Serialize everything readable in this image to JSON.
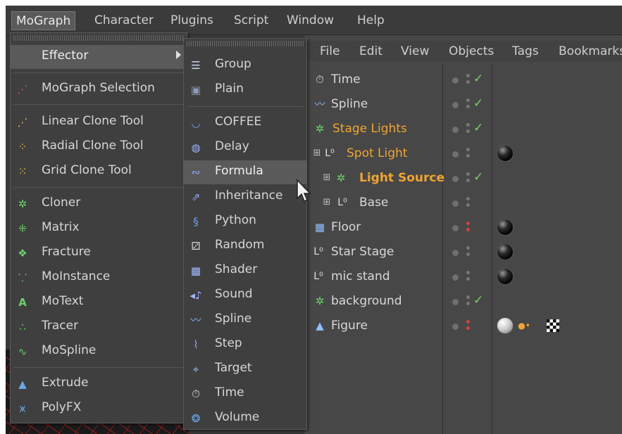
{
  "menubar": {
    "items": [
      "MoGraph",
      "Character",
      "Plugins",
      "Script",
      "Window",
      "Help"
    ]
  },
  "mograph_menu": {
    "items": [
      {
        "label": "Effector",
        "icon": "effector-submenu",
        "color": "#c8c8c8"
      },
      {
        "label": "MoGraph Selection",
        "icon": "mograph-selection-icon",
        "color": "#d25b5b"
      },
      {
        "label": "Linear Clone Tool",
        "icon": "linear-clone-icon",
        "color": "#e8c24a"
      },
      {
        "label": "Radial Clone Tool",
        "icon": "radial-clone-icon",
        "color": "#e8c24a"
      },
      {
        "label": "Grid Clone Tool",
        "icon": "grid-clone-icon",
        "color": "#e8c24a"
      },
      {
        "label": "Cloner",
        "icon": "cloner-icon",
        "color": "#6ccf6c"
      },
      {
        "label": "Matrix",
        "icon": "matrix-icon",
        "color": "#6ccf6c"
      },
      {
        "label": "Fracture",
        "icon": "fracture-icon",
        "color": "#6ccf6c"
      },
      {
        "label": "MoInstance",
        "icon": "moinstance-icon",
        "color": "#6ccf6c"
      },
      {
        "label": "MoText",
        "icon": "motext-icon",
        "color": "#6ccf6c"
      },
      {
        "label": "Tracer",
        "icon": "tracer-icon",
        "color": "#6ccf6c"
      },
      {
        "label": "MoSpline",
        "icon": "mospline-icon",
        "color": "#6ccf6c"
      },
      {
        "label": "Extrude",
        "icon": "extrude-icon",
        "color": "#6aa7e8"
      },
      {
        "label": "PolyFX",
        "icon": "polyfx-icon",
        "color": "#6aa7e8"
      }
    ]
  },
  "effector_menu": {
    "items": [
      {
        "label": "Group",
        "icon": "group-icon"
      },
      {
        "label": "Plain",
        "icon": "plain-icon"
      },
      {
        "label": "COFFEE",
        "icon": "coffee-icon"
      },
      {
        "label": "Delay",
        "icon": "delay-icon"
      },
      {
        "label": "Formula",
        "icon": "formula-icon"
      },
      {
        "label": "Inheritance",
        "icon": "inheritance-icon"
      },
      {
        "label": "Python",
        "icon": "python-icon"
      },
      {
        "label": "Random",
        "icon": "random-icon"
      },
      {
        "label": "Shader",
        "icon": "shader-icon"
      },
      {
        "label": "Sound",
        "icon": "sound-icon"
      },
      {
        "label": "Spline",
        "icon": "spline-icon"
      },
      {
        "label": "Step",
        "icon": "step-icon"
      },
      {
        "label": "Target",
        "icon": "target-icon"
      },
      {
        "label": "Time",
        "icon": "time-icon"
      },
      {
        "label": "Volume",
        "icon": "volume-icon"
      }
    ],
    "highlighted": "Formula"
  },
  "object_manager": {
    "menu": [
      "File",
      "Edit",
      "View",
      "Objects",
      "Tags",
      "Bookmarks"
    ],
    "objects": [
      {
        "name": "Time",
        "icon": "time-icon",
        "highlight": false,
        "checked": true,
        "tags": []
      },
      {
        "name": "Spline",
        "icon": "spline-icon",
        "highlight": false,
        "checked": true,
        "tags": []
      },
      {
        "name": "Stage Lights",
        "icon": "cloner-icon",
        "highlight": true,
        "checked": true,
        "tags": []
      },
      {
        "name": "Spot Light",
        "icon": "null-icon",
        "highlight": true,
        "checked": false,
        "tags": [
          "material-black"
        ]
      },
      {
        "name": "Light Source",
        "icon": "cloner-icon",
        "highlight": true,
        "checked": true,
        "tags": []
      },
      {
        "name": "Base",
        "icon": "null-icon",
        "highlight": false,
        "checked": false,
        "tags": []
      },
      {
        "name": "Floor",
        "icon": "floor-icon",
        "highlight": false,
        "checked": false,
        "tags": [
          "material-black"
        ]
      },
      {
        "name": "Star Stage",
        "icon": "null-icon",
        "highlight": false,
        "checked": false,
        "tags": [
          "material-black"
        ]
      },
      {
        "name": "mic stand",
        "icon": "null-icon",
        "highlight": false,
        "checked": false,
        "tags": [
          "material-black"
        ]
      },
      {
        "name": "background",
        "icon": "cloner-icon",
        "highlight": false,
        "checked": true,
        "tags": []
      },
      {
        "name": "Figure",
        "icon": "figure-icon",
        "highlight": false,
        "checked": false,
        "tags": [
          "material-white",
          "ik-tag",
          "checker-tag"
        ]
      }
    ]
  }
}
